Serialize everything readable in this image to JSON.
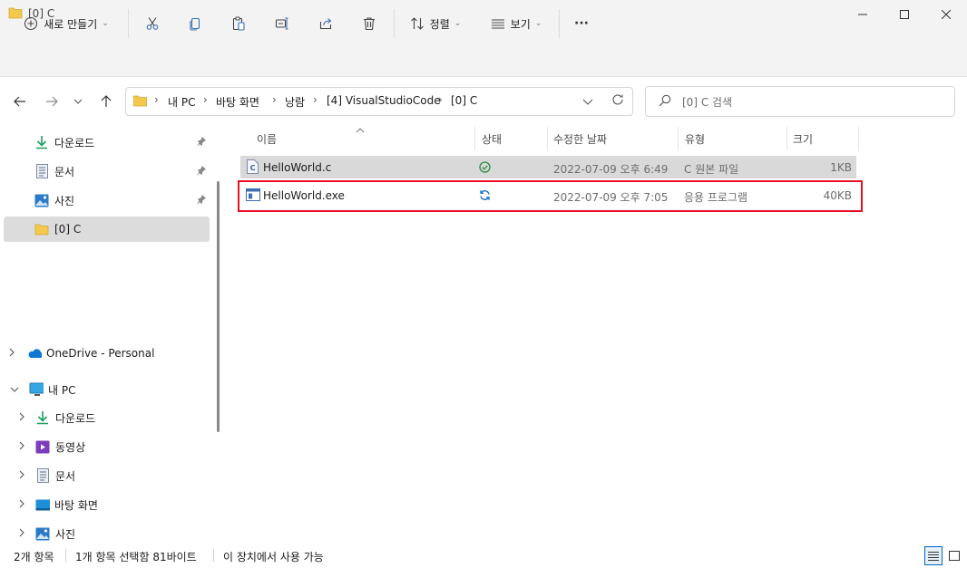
{
  "window": {
    "title": "[0] C"
  },
  "toolbar": {
    "new_label": "새로 만들기",
    "sort_label": "정렬",
    "view_label": "보기",
    "more_label": "···"
  },
  "address": {
    "crumbs": [
      "내 PC",
      "바탕 화면",
      "낭람",
      "[4] VisualStudioCode",
      "[0] C"
    ]
  },
  "search": {
    "placeholder": "[0] C 검색"
  },
  "sidebar": {
    "quick": [
      {
        "label": "다운로드",
        "icon": "download-icon"
      },
      {
        "label": "문서",
        "icon": "document-icon"
      },
      {
        "label": "사진",
        "icon": "pictures-icon"
      },
      {
        "label": "[0] C",
        "icon": "folder-icon"
      }
    ],
    "onedrive": "OneDrive - Personal",
    "thispc": "내 PC",
    "pc_items": [
      {
        "label": "다운로드",
        "icon": "download-icon"
      },
      {
        "label": "동영상",
        "icon": "video-icon"
      },
      {
        "label": "문서",
        "icon": "document-icon"
      },
      {
        "label": "바탕 화면",
        "icon": "desktop-icon"
      },
      {
        "label": "사진",
        "icon": "pictures-icon"
      }
    ]
  },
  "columns": {
    "name": "이름",
    "status": "상태",
    "modified": "수정한 날짜",
    "type": "유형",
    "size": "크기"
  },
  "files": [
    {
      "name": "HelloWorld.c",
      "modified": "2022-07-09 오후 6:49",
      "type": "C 원본 파일",
      "size": "1KB",
      "status": "synced"
    },
    {
      "name": "HelloWorld.exe",
      "modified": "2022-07-09 오후 7:05",
      "type": "응용 프로그램",
      "size": "40KB",
      "status": "syncing"
    }
  ],
  "statusbar": {
    "count": "2개 항목",
    "selection": "1개 항목 선택함 81바이트",
    "availability": "이 장치에서 사용 가능"
  },
  "colors": {
    "selection_bg": "#d9d9d9",
    "highlight_border": "#e81123",
    "accent": "#0067c0",
    "folder": "#f2c94c"
  }
}
